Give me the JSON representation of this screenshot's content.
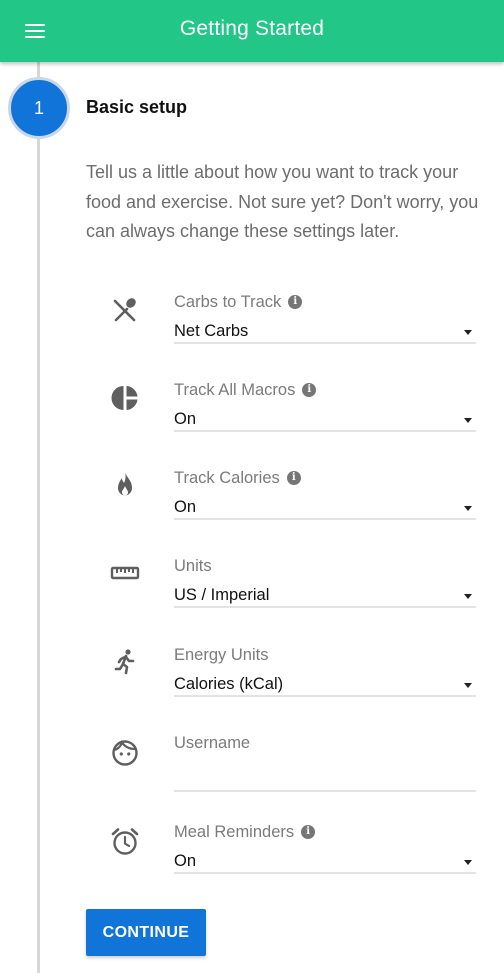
{
  "appbar": {
    "title": "Getting Started",
    "menu_icon": "hamburger-menu-icon"
  },
  "step": {
    "number": "1",
    "title": "Basic setup"
  },
  "intro": "Tell us a little about how you want to track your food and exercise. Not sure yet? Don't worry, you can always change these settings later.",
  "fields": {
    "carbs": {
      "label": "Carbs to Track",
      "value": "Net Carbs",
      "icon": "utensils-icon",
      "info_icon": "info-icon"
    },
    "macros": {
      "label": "Track All Macros",
      "value": "On",
      "icon": "pie-chart-icon",
      "info_icon": "info-icon"
    },
    "calories": {
      "label": "Track Calories",
      "value": "On",
      "icon": "flame-icon",
      "info_icon": "info-icon"
    },
    "units": {
      "label": "Units",
      "value": "US / Imperial",
      "icon": "ruler-icon"
    },
    "energy": {
      "label": "Energy Units",
      "value": "Calories (kCal)",
      "icon": "running-person-icon"
    },
    "username": {
      "label": "Username",
      "value": "",
      "icon": "face-icon"
    },
    "reminders": {
      "label": "Meal Reminders",
      "value": "On",
      "icon": "alarm-clock-icon",
      "info_icon": "info-icon"
    }
  },
  "continue_label": "CONTINUE",
  "colors": {
    "appbar": "#22c686",
    "primary": "#1174d8",
    "rail": "#d6d6d6"
  }
}
